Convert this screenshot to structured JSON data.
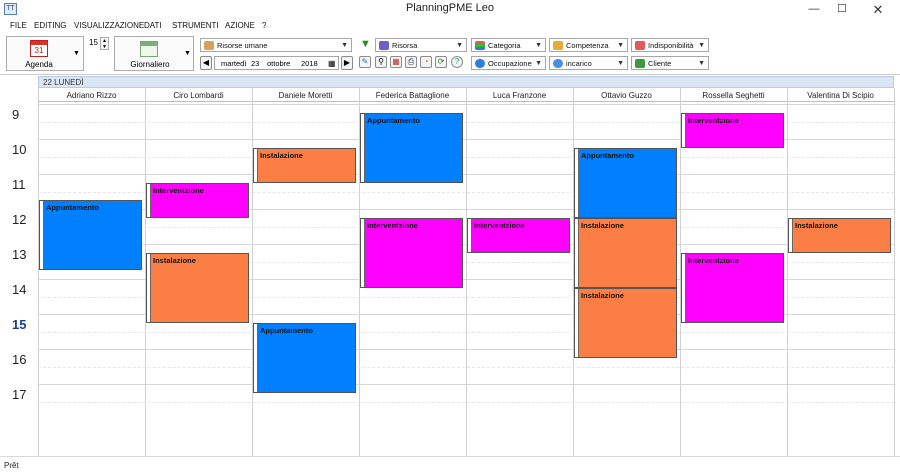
{
  "window": {
    "title": "PlanningPME Leo",
    "icon": "app-icon",
    "icon_text": "TT"
  },
  "menu": [
    "FILE",
    "EDITING",
    "VISUALIZZAZIONE",
    "DATI",
    "STRUMENTI",
    "AZIONE",
    "?"
  ],
  "toolbar": {
    "agenda_label": "Agenda",
    "agenda_day": "31",
    "zoom_value": "15",
    "view_label": "Giornaliero",
    "resource_combo": "Risorse umane",
    "date": {
      "weekday": "martedì",
      "day": "23",
      "month": "ottobre",
      "year": "2018"
    },
    "filters": {
      "risorsa": "Risorsa",
      "categoria": "Categoria",
      "competenza": "Competenza",
      "indisponibilita": "Indisponibilità",
      "occupazione": "Occupazione",
      "incarico": "incarico",
      "cliente": "Cliente"
    }
  },
  "calendar": {
    "day_header": "22 LUNEDÌ",
    "resources": [
      "Adriano Rizzo",
      "Ciro Lombardi",
      "Daniele Moretti",
      "Federica Battaglione",
      "Luca Franzone",
      "Ottavio Guzzo",
      "Rossella Seghetti",
      "Valentina Di Scipio"
    ],
    "hours": [
      "9",
      "10",
      "11",
      "12",
      "13",
      "14",
      "15",
      "16",
      "17"
    ],
    "current_hour": "15",
    "events": [
      {
        "resource": 0,
        "start": 11.25,
        "end": 13.25,
        "label": "Appuntamento",
        "color": "#0080ff"
      },
      {
        "resource": 1,
        "start": 10.75,
        "end": 11.75,
        "label": "Interventzione",
        "color": "#ff00ff"
      },
      {
        "resource": 1,
        "start": 12.75,
        "end": 14.75,
        "label": "Instalazione",
        "color": "#fb7f44"
      },
      {
        "resource": 2,
        "start": 9.75,
        "end": 10.75,
        "label": "Instalazione",
        "color": "#fb7f44"
      },
      {
        "resource": 2,
        "start": 14.75,
        "end": 16.75,
        "label": "Appuntamento",
        "color": "#0080ff"
      },
      {
        "resource": 3,
        "start": 8.75,
        "end": 10.75,
        "label": "Appuntamento",
        "color": "#0080ff"
      },
      {
        "resource": 3,
        "start": 11.75,
        "end": 13.75,
        "label": "Interventzione",
        "color": "#ff00ff"
      },
      {
        "resource": 4,
        "start": 11.75,
        "end": 12.75,
        "label": "Interventzione",
        "color": "#ff00ff"
      },
      {
        "resource": 5,
        "start": 9.75,
        "end": 11.75,
        "label": "Appuntamento",
        "color": "#0080ff"
      },
      {
        "resource": 5,
        "start": 11.75,
        "end": 13.75,
        "label": "Instalazione",
        "color": "#fb7f44"
      },
      {
        "resource": 5,
        "start": 13.75,
        "end": 15.75,
        "label": "Instalazione",
        "color": "#fb7f44"
      },
      {
        "resource": 6,
        "start": 8.75,
        "end": 9.75,
        "label": "Interventzione",
        "color": "#ff00ff"
      },
      {
        "resource": 6,
        "start": 12.75,
        "end": 14.75,
        "label": "Interventzione",
        "color": "#ff00ff"
      },
      {
        "resource": 7,
        "start": 11.75,
        "end": 12.75,
        "label": "Instalazione",
        "color": "#fb7f44"
      }
    ]
  },
  "status": "Prêt"
}
